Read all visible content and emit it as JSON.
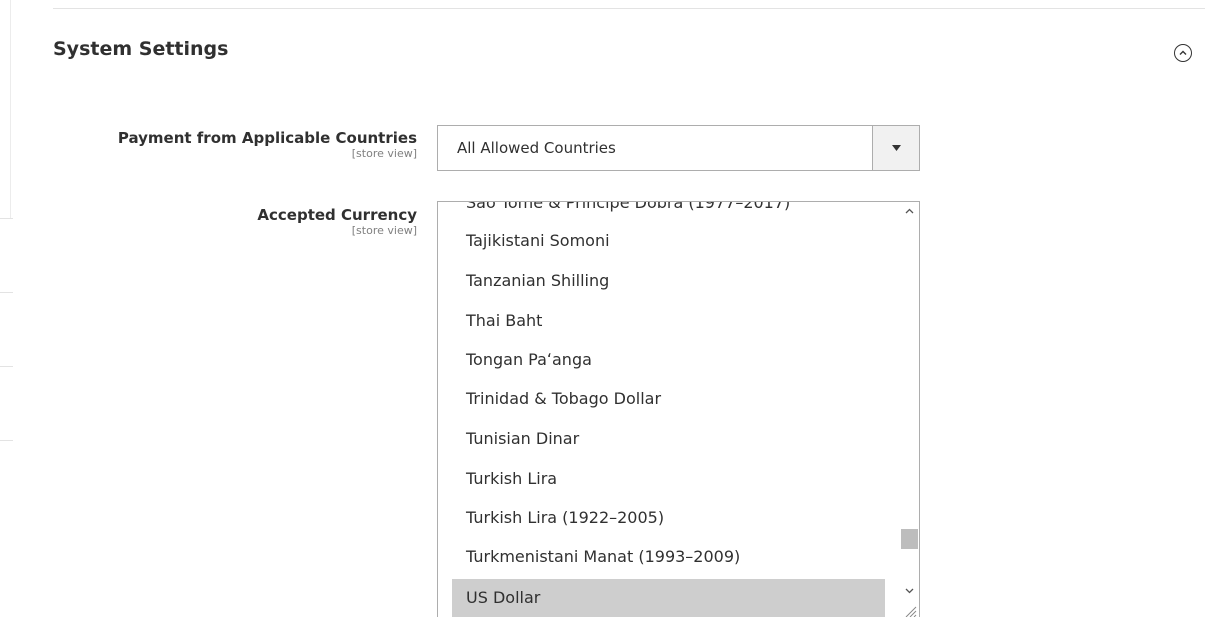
{
  "section": {
    "title": "System Settings"
  },
  "payment_countries": {
    "label": "Payment from Applicable Countries",
    "scope": "[store view]",
    "selected_value": "All Allowed Countries"
  },
  "accepted_currency": {
    "label": "Accepted Currency",
    "scope": "[store view]",
    "options": [
      "São Tomé & Príncipe Dobra (1977–2017)",
      "Tajikistani Somoni",
      "Tanzanian Shilling",
      "Thai Baht",
      "Tongan Paʻanga",
      "Trinidad & Tobago Dollar",
      "Tunisian Dinar",
      "Turkish Lira",
      "Turkish Lira (1922–2005)",
      "Turkmenistani Manat (1993–2009)",
      "US Dollar"
    ],
    "selected_option": "US Dollar"
  },
  "icons": {
    "collapse": "chevron-up-circle-icon",
    "dropdown": "caret-down-icon",
    "scroll_up": "chevron-up-icon",
    "scroll_down": "chevron-down-icon",
    "resize": "resize-grip-icon"
  },
  "colors": {
    "selected_option_bg": "#cecece",
    "border": "#adadad",
    "text": "#303030",
    "scope_text": "#808080"
  }
}
